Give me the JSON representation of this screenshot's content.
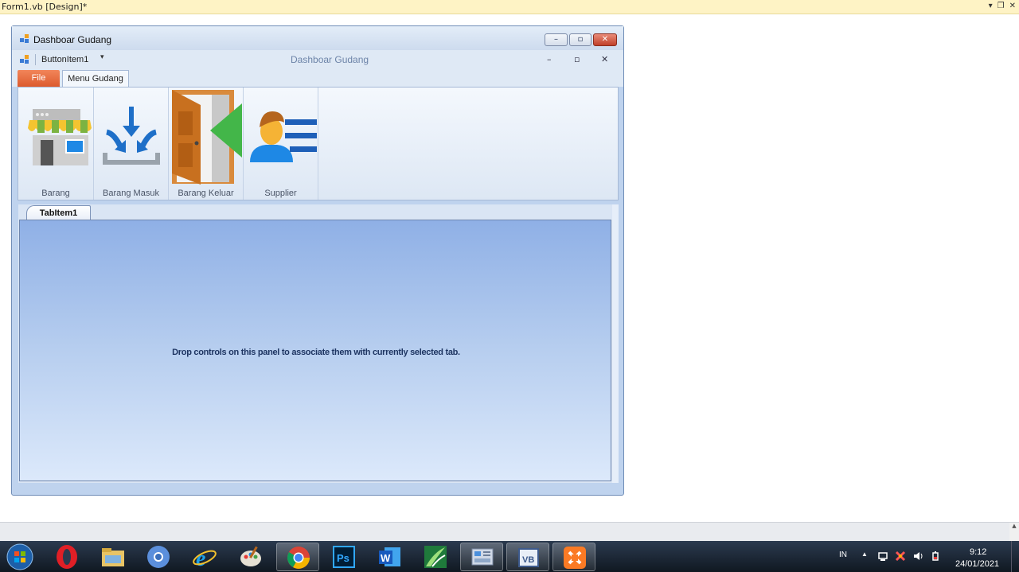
{
  "document": {
    "title": "Form1.vb [Design]*"
  },
  "form": {
    "title": "Dashboar Gudang",
    "window_buttons": {
      "minimize": "–",
      "maximize": "▫",
      "close": "✕"
    }
  },
  "ribbon": {
    "qat_item": "ButtonItem1",
    "qat_arrow": "▾",
    "title": "Dashboar Gudang",
    "mdi_buttons": {
      "minimize": "–",
      "restore": "▫",
      "close": "✕"
    },
    "tabs": {
      "file": "File",
      "menu_gudang": "Menu Gudang"
    },
    "buttons": [
      {
        "label": "Barang",
        "icon": "store-icon"
      },
      {
        "label": "Barang Masuk",
        "icon": "download-inbox-icon"
      },
      {
        "label": "Barang Keluar",
        "icon": "exit-door-icon"
      },
      {
        "label": "Supplier",
        "icon": "supplier-list-icon"
      }
    ]
  },
  "tab_control": {
    "tab_label": "TabItem1",
    "hint": "Drop controls on this panel to associate them with currently selected tab."
  },
  "taskbar": {
    "apps": [
      "start-orb",
      "opera-icon",
      "file-explorer-icon",
      "chromium-icon",
      "internet-explorer-icon",
      "paint-icon",
      "chrome-icon",
      "photoshop-icon",
      "word-icon",
      "corel-icon",
      "control-panel-icon",
      "visual-basic-icon",
      "xampp-icon"
    ],
    "tray": {
      "language": "IN",
      "time": "9:12",
      "date": "24/01/2021"
    }
  }
}
